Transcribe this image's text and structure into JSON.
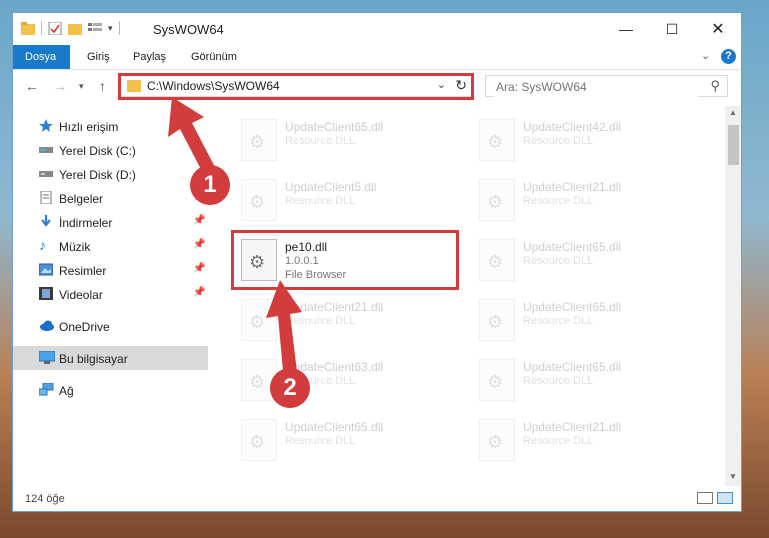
{
  "window": {
    "title": "SysWOW64"
  },
  "ribbon": {
    "tabs": [
      "Dosya",
      "Giriş",
      "Paylaş",
      "Görünüm"
    ]
  },
  "address": {
    "path": "C:\\Windows\\SysWOW64"
  },
  "search": {
    "placeholder": "Ara: SysWOW64"
  },
  "sidebar": {
    "items": [
      {
        "label": "Hızlı erişim",
        "icon": "star-icon"
      },
      {
        "label": "Yerel Disk (C:)",
        "icon": "drive-icon"
      },
      {
        "label": "Yerel Disk (D:)",
        "icon": "drive-icon"
      },
      {
        "label": "Belgeler",
        "icon": "documents-icon",
        "pinned": true
      },
      {
        "label": "İndirmeler",
        "icon": "downloads-icon",
        "pinned": true
      },
      {
        "label": "Müzik",
        "icon": "music-icon",
        "pinned": true
      },
      {
        "label": "Resimler",
        "icon": "pictures-icon",
        "pinned": true
      },
      {
        "label": "Videolar",
        "icon": "videos-icon",
        "pinned": true
      },
      {
        "label": "OneDrive",
        "icon": "cloud-icon"
      },
      {
        "label": "Bu bilgisayar",
        "icon": "computer-icon",
        "selected": true
      },
      {
        "label": "Ağ",
        "icon": "network-icon"
      }
    ]
  },
  "files": {
    "left": [
      {
        "name": "UpdateClient65.dll",
        "desc": "Resource DLL"
      },
      {
        "name": "UpdateClient5.dll",
        "desc": "Resource DLL"
      },
      {
        "name": "pe10.dll",
        "version": "1.0.0.1",
        "desc": "File Browser"
      },
      {
        "name": "UpdateClient21.dll",
        "desc": "Resource DLL"
      },
      {
        "name": "UpdateClient63.dll",
        "desc": "Resource DLL"
      },
      {
        "name": "UpdateClient65.dll",
        "desc": "Resource DLL"
      }
    ],
    "right": [
      {
        "name": "UpdateClient42.dll",
        "desc": "Resource DLL"
      },
      {
        "name": "UpdateClient21.dll",
        "desc": "Resource DLL"
      },
      {
        "name": "UpdateClient65.dll",
        "desc": "Resource DLL"
      },
      {
        "name": "UpdateClient65.dll",
        "desc": "Resource DLL"
      },
      {
        "name": "UpdateClient65.dll",
        "desc": "Resource DLL"
      },
      {
        "name": "UpdateClient21.dll",
        "desc": "Resource DLL"
      }
    ]
  },
  "status": {
    "count": "124 öğe"
  },
  "annotations": {
    "badge1": "1",
    "badge2": "2"
  },
  "colors": {
    "accent": "#1979ca",
    "highlight": "#d23c3c"
  }
}
